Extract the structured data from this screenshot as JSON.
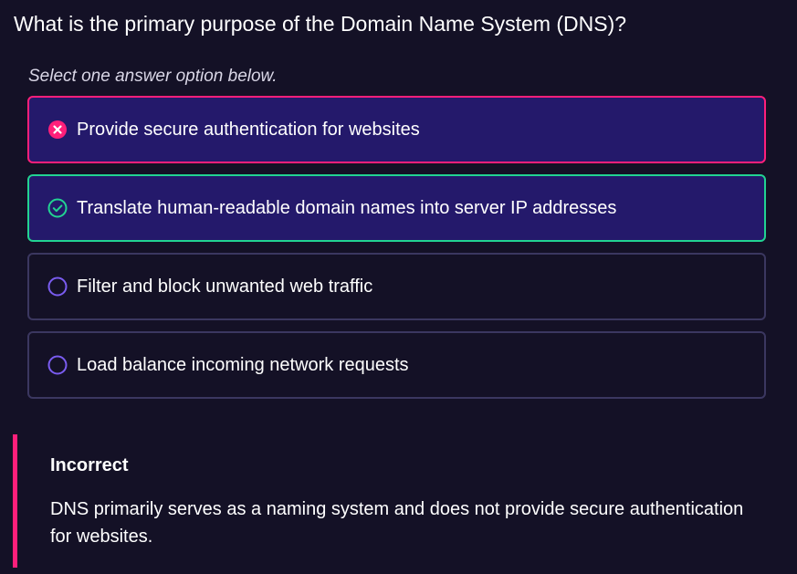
{
  "question": {
    "text": "What is the primary purpose of the Domain Name System (DNS)?"
  },
  "instruction": "Select one answer option below.",
  "options": [
    {
      "label": "Provide secure authentication for websites",
      "state": "incorrect",
      "icon": "x-circle-icon"
    },
    {
      "label": "Translate human-readable domain names into server IP addresses",
      "state": "correct",
      "icon": "check-circle-icon"
    },
    {
      "label": "Filter and block unwanted web traffic",
      "state": "unselected",
      "icon": "radio-empty-icon"
    },
    {
      "label": "Load balance incoming network requests",
      "state": "unselected",
      "icon": "radio-empty-icon"
    }
  ],
  "feedback": {
    "title": "Incorrect",
    "body": "DNS primarily serves as a naming system and does not provide secure authentication for websites."
  },
  "colors": {
    "background": "#141126",
    "incorrect": "#ff1f7a",
    "correct": "#22d392",
    "selected_bg": "#24196b",
    "border": "#3b3760",
    "radio": "#7a5cf0"
  }
}
